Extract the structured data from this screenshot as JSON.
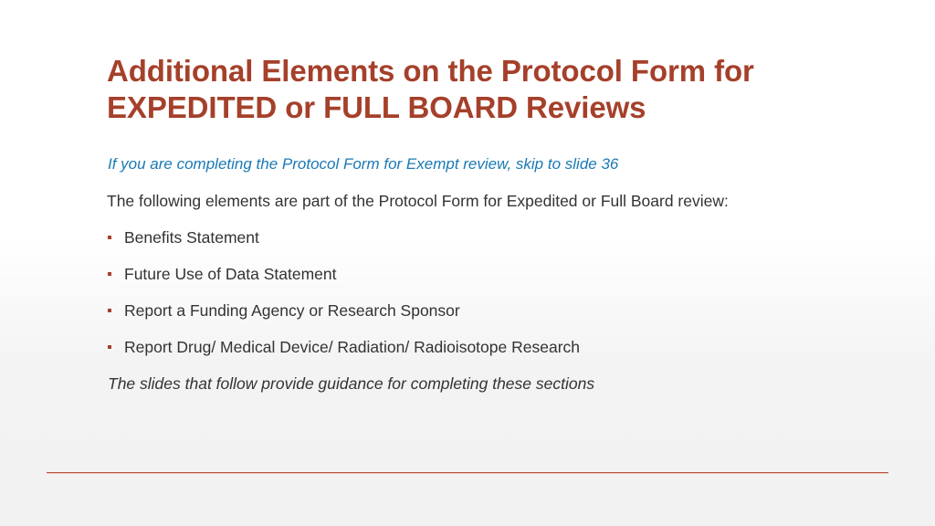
{
  "slide": {
    "title_lines": [
      "Additional Elements on the Protocol Form for",
      "EXPEDITED or FULL BOARD Reviews"
    ],
    "note": "If you are completing the Protocol Form for Exempt review, skip to slide 36",
    "intro": "The following elements are part of the Protocol Form for Expedited or Full Board review:",
    "bullets": [
      "Benefits Statement",
      "Future Use of Data Statement",
      "Report a Funding Agency or Research Sponsor",
      "Report Drug/ Medical Device/ Radiation/ Radioisotope Research"
    ],
    "closing": "The slides that follow provide guidance for completing these sections"
  },
  "colors": {
    "title": "#a5402a",
    "note": "#1a79b4",
    "body_text": "#333333",
    "bullet": "#a5402a",
    "divider": "#b5533c"
  }
}
